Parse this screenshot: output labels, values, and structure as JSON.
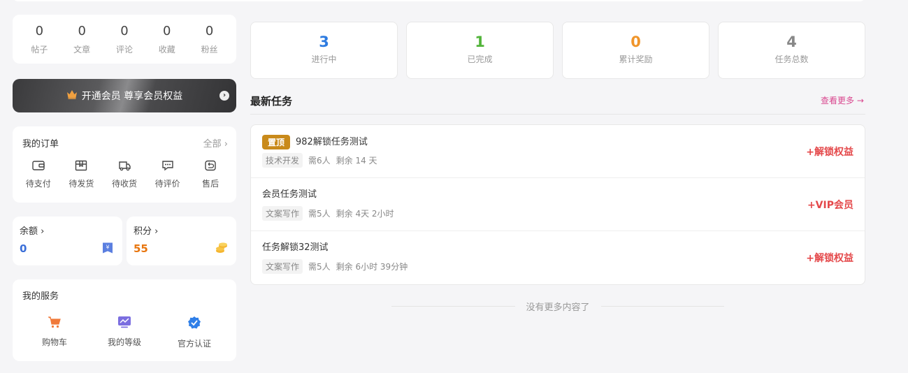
{
  "stats": [
    {
      "value": "0",
      "label": "帖子"
    },
    {
      "value": "0",
      "label": "文章"
    },
    {
      "value": "0",
      "label": "评论"
    },
    {
      "value": "0",
      "label": "收藏"
    },
    {
      "value": "0",
      "label": "粉丝"
    }
  ],
  "vip": {
    "label": "开通会员 尊享会员权益"
  },
  "orders": {
    "title": "我的订单",
    "all": "全部 ›",
    "items": [
      {
        "label": "待支付",
        "icon": "wallet-icon"
      },
      {
        "label": "待发货",
        "icon": "box-icon"
      },
      {
        "label": "待收货",
        "icon": "truck-icon"
      },
      {
        "label": "待评价",
        "icon": "chat-icon"
      },
      {
        "label": "售后",
        "icon": "return-icon"
      }
    ]
  },
  "balance": {
    "label": "余额 ›",
    "value": "0",
    "color": "#3b6fd8"
  },
  "points": {
    "label": "积分 ›",
    "value": "55",
    "color": "#e8760f"
  },
  "services": {
    "title": "我的服务",
    "items": [
      {
        "label": "购物车",
        "icon": "cart-icon"
      },
      {
        "label": "我的等级",
        "icon": "level-icon"
      },
      {
        "label": "官方认证",
        "icon": "verified-icon"
      }
    ]
  },
  "task_stats": [
    {
      "value": "3",
      "label": "进行中",
      "color": "#2d7be0"
    },
    {
      "value": "1",
      "label": "已完成",
      "color": "#52b43a"
    },
    {
      "value": "0",
      "label": "累计奖励",
      "color": "#f0952a"
    },
    {
      "value": "4",
      "label": "任务总数",
      "color": "#888888"
    }
  ],
  "section": {
    "title": "最新任务",
    "more": "查看更多 →"
  },
  "tasks": [
    {
      "badge": "置顶",
      "title": "982解锁任务测试",
      "tag": "技术开发",
      "people": "需6人",
      "remain": "剩余 14 天",
      "reward": "+解锁权益"
    },
    {
      "badge": "",
      "title": "会员任务测试",
      "tag": "文案写作",
      "people": "需5人",
      "remain": "剩余 4天 2小时",
      "reward": "+VIP会员"
    },
    {
      "badge": "",
      "title": "任务解锁32测试",
      "tag": "文案写作",
      "people": "需5人",
      "remain": "剩余 6小时 39分钟",
      "reward": "+解锁权益"
    }
  ],
  "footer": {
    "no_more": "没有更多内容了"
  }
}
